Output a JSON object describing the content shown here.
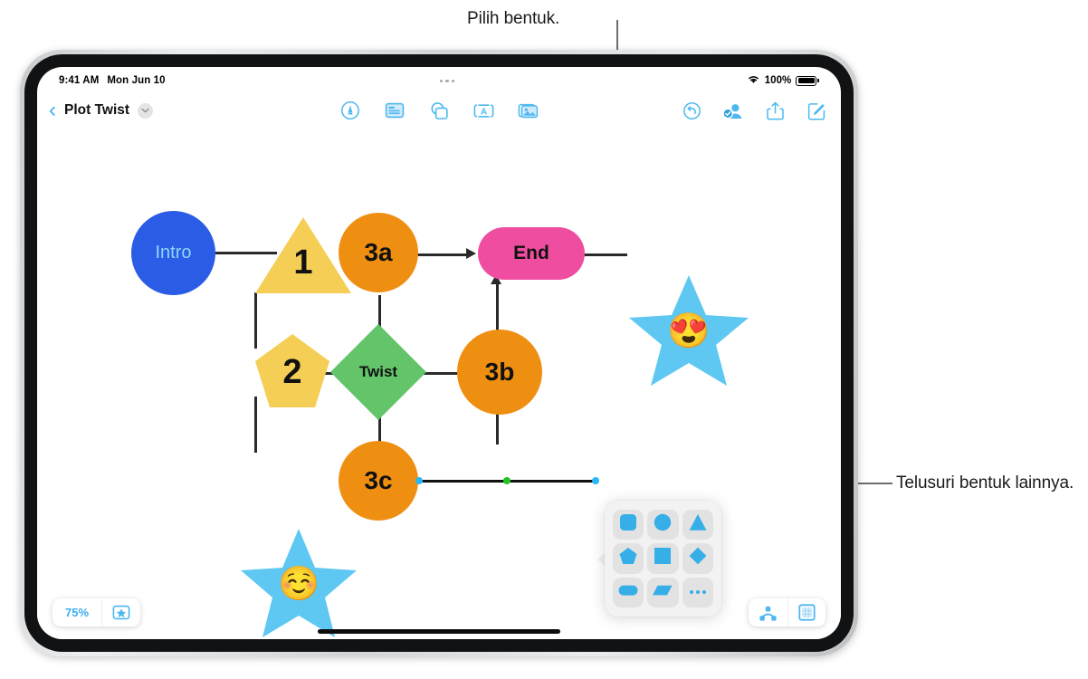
{
  "callouts": [
    {
      "id": "top",
      "text": "Pilih bentuk."
    },
    {
      "id": "right",
      "text": "Telusuri bentuk lainnya."
    }
  ],
  "status_bar": {
    "time": "9:41 AM",
    "date": "Mon Jun 10",
    "wifi_icon": "wifi-icon",
    "battery_percent": "100%",
    "battery_icon": "battery-full-icon"
  },
  "toolbar": {
    "back_icon": "chevron-left-icon",
    "document_title": "Plot Twist",
    "title_chevron_icon": "chevron-down-icon",
    "overflow_icon": "ellipsis-icon",
    "center_tools": [
      {
        "name": "draw-tool",
        "icon": "pen-in-circle-icon"
      },
      {
        "name": "text-tool",
        "icon": "text-box-icon"
      },
      {
        "name": "shapes-tool",
        "icon": "shapes-icon"
      },
      {
        "name": "sticker-text-tool",
        "icon": "letter-a-box-icon"
      },
      {
        "name": "media-tool",
        "icon": "photos-icon"
      }
    ],
    "right_tools": [
      {
        "name": "undo-button",
        "icon": "undo-icon"
      },
      {
        "name": "collaborate-button",
        "icon": "person-badge-icon"
      },
      {
        "name": "share-button",
        "icon": "share-icon"
      },
      {
        "name": "compose-button",
        "icon": "compose-icon"
      }
    ]
  },
  "canvas": {
    "nodes": [
      {
        "id": "intro",
        "label": "Intro",
        "shape": "circle",
        "color": "#2b5ce6",
        "text_color": "#8fd6f5"
      },
      {
        "id": "n1",
        "label": "1",
        "shape": "triangle",
        "color": "#f5ce56",
        "text_color": "#111111"
      },
      {
        "id": "n2",
        "label": "2",
        "shape": "pentagon",
        "color": "#f5ce56",
        "text_color": "#111111"
      },
      {
        "id": "n3a",
        "label": "3a",
        "shape": "circle",
        "color": "#ef8f12",
        "text_color": "#111111"
      },
      {
        "id": "n3b",
        "label": "3b",
        "shape": "circle",
        "color": "#ef8f12",
        "text_color": "#111111"
      },
      {
        "id": "n3c",
        "label": "3c",
        "shape": "circle",
        "color": "#ef8f12",
        "text_color": "#111111"
      },
      {
        "id": "twist",
        "label": "Twist",
        "shape": "diamond",
        "color": "#63c46a",
        "text_color": "#111111"
      },
      {
        "id": "end",
        "label": "End",
        "shape": "rounded-rect",
        "color": "#ef4ea0",
        "text_color": "#111111"
      },
      {
        "id": "star1",
        "label": "😍",
        "shape": "star",
        "color": "#5ec8f2",
        "text_color": "#111111"
      },
      {
        "id": "star2",
        "label": "☺️",
        "shape": "star",
        "color": "#5ec8f2",
        "text_color": "#111111"
      }
    ],
    "selected_connector": {
      "name": "selected-connector",
      "start_handle": "blue-endpoint-handle",
      "mid_handle": "green-midpoint-handle",
      "end_handle": "blue-endpoint-handle"
    }
  },
  "shape_picker": {
    "name": "shape-picker-popover",
    "cells": [
      {
        "name": "rounded-square-shape",
        "icon": "rounded-square-icon"
      },
      {
        "name": "circle-shape",
        "icon": "circle-icon"
      },
      {
        "name": "triangle-shape",
        "icon": "triangle-icon"
      },
      {
        "name": "pentagon-shape",
        "icon": "pentagon-icon"
      },
      {
        "name": "square-shape",
        "icon": "square-icon"
      },
      {
        "name": "diamond-shape",
        "icon": "diamond-icon"
      },
      {
        "name": "oval-shape",
        "icon": "oval-icon"
      },
      {
        "name": "parallelogram-shape",
        "icon": "parallelogram-icon"
      },
      {
        "name": "more-shapes",
        "icon": "ellipsis-icon"
      }
    ]
  },
  "bottom_bar": {
    "zoom_level": "75%",
    "favorites_icon": "star-in-box-icon",
    "organize_icon": "node-graph-icon",
    "canvas_icon": "grid-square-icon"
  },
  "colors": {
    "accent": "#3aaff0",
    "selection_blue": "#29b6f6",
    "selection_green": "#21c521",
    "edge": "#2a2a2a"
  }
}
